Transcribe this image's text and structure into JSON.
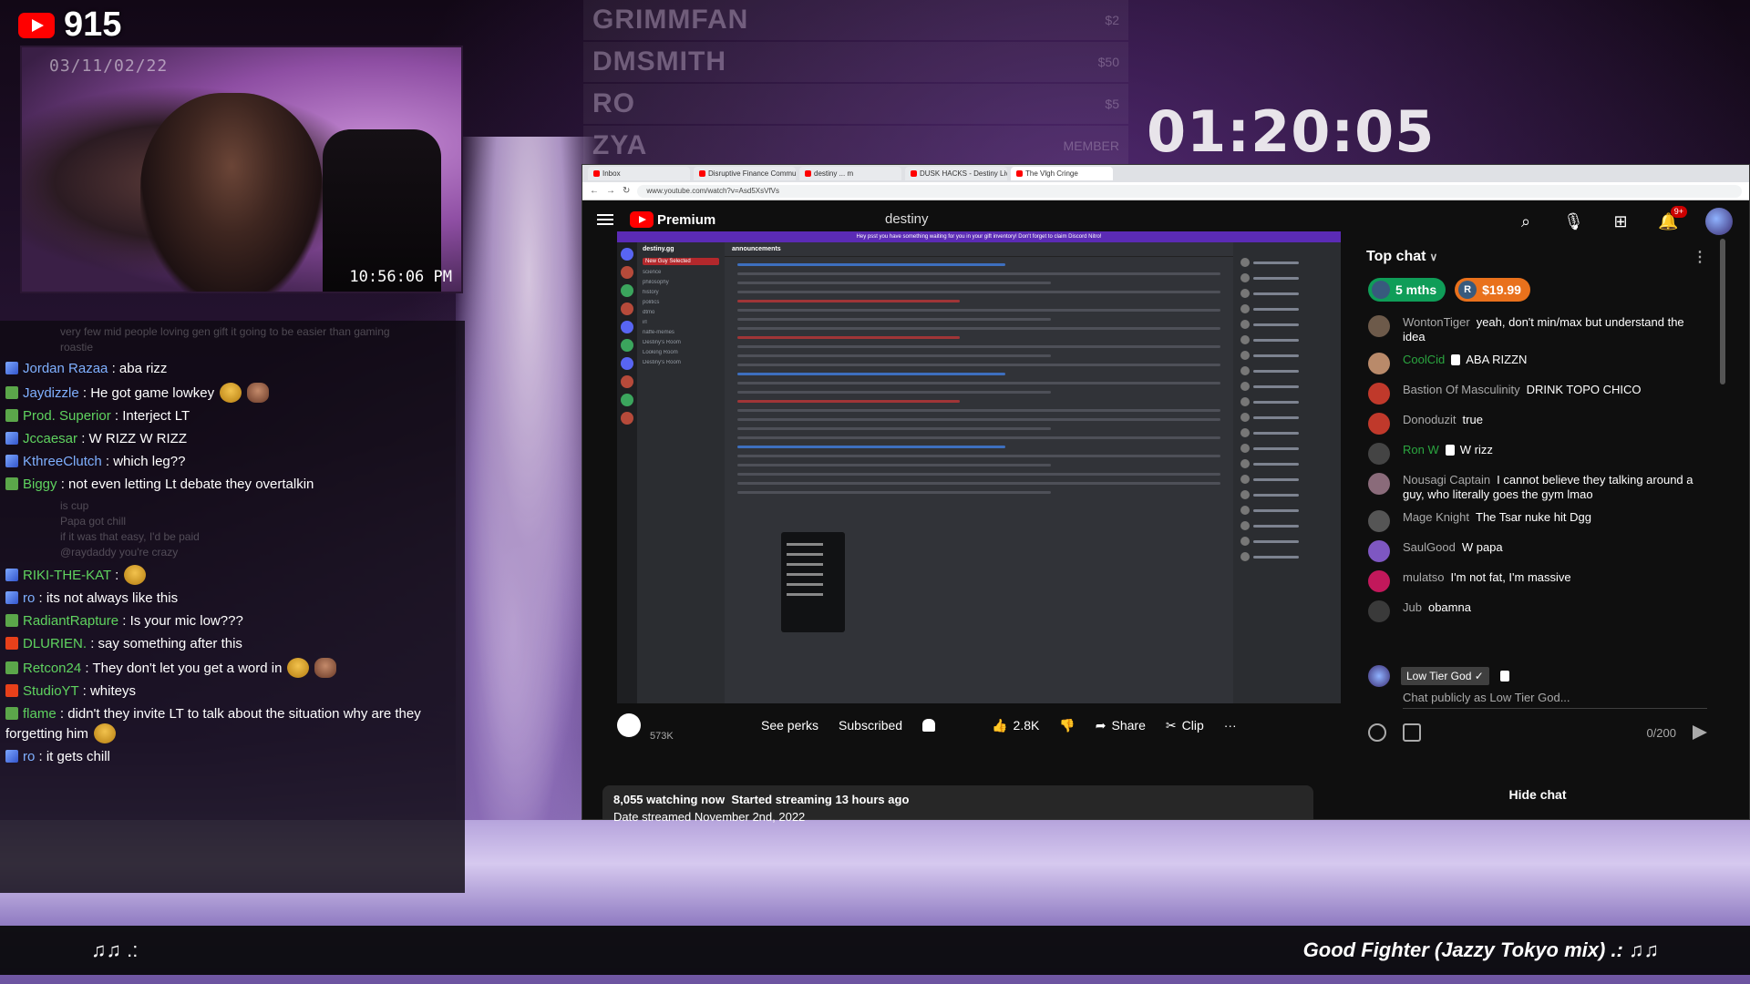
{
  "stream": {
    "viewer_count": "915",
    "timer": "01:20:05",
    "webcam_date": "03/11/02/22",
    "webcam_clock": "10:56:06 PM"
  },
  "leaderboard": [
    {
      "name": "GRIMMFAN",
      "value": "$2"
    },
    {
      "name": "DMSMITH",
      "value": "$50"
    },
    {
      "name": "RO",
      "value": "$5"
    },
    {
      "name": "ZYA",
      "value": "MEMBER"
    }
  ],
  "left_chat": {
    "faint_top": "very few mid people loving gen gift it going to be easier than gaming",
    "faint_top2": "roastie",
    "messages": [
      {
        "user": "Jordan Razaa",
        "color": "#7fb0ff",
        "badge": "sword",
        "text": ": aba rizz"
      },
      {
        "user": "Jaydizzle",
        "color": "#7fb0ff",
        "badge": "hat",
        "text": ": He got game lowkey",
        "emotes": 2
      },
      {
        "user": "Prod. Superior",
        "color": "#5fd35f",
        "badge": "hat",
        "text": ": Interject LT"
      },
      {
        "user": "Jccaesar",
        "color": "#5fd35f",
        "badge": "sword",
        "text": ": W RIZZ W RIZZ"
      },
      {
        "user": "KthreeClutch",
        "color": "#7fb0ff",
        "badge": "sword",
        "text": ": which leg??"
      },
      {
        "user": "Biggy",
        "color": "#5fd35f",
        "badge": "hat",
        "text": ": not even letting Lt debate they overtalkin"
      },
      {
        "user": "RIKI-THE-KAT",
        "color": "#5fd35f",
        "badge": "sword",
        "text": ":",
        "emotes": 1
      },
      {
        "user": "ro",
        "color": "#7fb0ff",
        "badge": "sword",
        "text": ": its not always like this"
      },
      {
        "user": "RadiantRapture",
        "color": "#5fd35f",
        "badge": "hat",
        "text": ": Is your mic low???"
      },
      {
        "user": "DLURIEN.",
        "color": "#5fd35f",
        "badge": "fire",
        "text": ": say something after this"
      },
      {
        "user": "Retcon24",
        "color": "#5fd35f",
        "badge": "hat",
        "text": ": They don't let you get a word in",
        "emotes": 2
      },
      {
        "user": "StudioYT",
        "color": "#5fd35f",
        "badge": "fire",
        "text": ": whiteys"
      },
      {
        "user": "flame",
        "color": "#5fd35f",
        "badge": "hat",
        "text": ": didn't they invite LT to talk about the situation why are they forgetting him",
        "emotes": 1
      },
      {
        "user": "ro",
        "color": "#7fb0ff",
        "badge": "sword",
        "text": ": it gets chill"
      }
    ],
    "faint_mid": [
      "is cup",
      "Papa got chill",
      "if it was that easy, I'd be paid",
      "@raydaddy you're crazy"
    ]
  },
  "browser": {
    "tabs": [
      "Inbox",
      "Disruptive Finance Commu...",
      "destiny ... m",
      "DUSK HACKS - Destiny Live ...",
      "The Vlgh Cringe"
    ],
    "address": "www.youtube.com/watch?v=Asd5XsVfVs",
    "yt_premium": "Premium",
    "search_query": "destiny",
    "notif_count": "9+"
  },
  "video": {
    "discord_banner": "Hey psst you have something waiting for you in your gift inventory! Don't forget to claim Discord Nitro!",
    "guild_name": "destiny.gg",
    "channel_header": "announcements",
    "channels": [
      "New Guy Selected",
      "science",
      "philosophy",
      "history",
      "politics",
      "dtmo",
      "irl",
      "naffe-memes",
      "Destiny's Room",
      "Looking Room",
      "Destiny's Room"
    ]
  },
  "actions": {
    "subs": "573K",
    "see_perks": "See perks",
    "subscribed": "Subscribed",
    "likes": "2.8K",
    "share": "Share",
    "clip": "Clip",
    "more": "···"
  },
  "info": {
    "watching": "8,055 watching now",
    "started": "Started streaming 13 hours ago",
    "date": "Date streamed November 2nd, 2022"
  },
  "live_chat": {
    "header": "Top chat",
    "ticker": [
      {
        "label": "5 mths",
        "initial": "",
        "color": "#0f9d58"
      },
      {
        "label": "$19.99",
        "initial": "R",
        "color": "#e9711c"
      }
    ],
    "messages": [
      {
        "author": "WontonTiger",
        "member": false,
        "text": "yeah, don't min/max but understand the idea",
        "avatar_color": "#6d5a4a"
      },
      {
        "author": "CoolCid",
        "member": true,
        "text": "ABA RIZZN",
        "avatar_color": "#b98a6a"
      },
      {
        "author": "Bastion Of Masculinity",
        "member": false,
        "text": "DRINK TOPO CHICO",
        "avatar_color": "#c0392b"
      },
      {
        "author": "Donoduzit",
        "member": false,
        "text": "true",
        "avatar_color": "#c0392b"
      },
      {
        "author": "Ron W",
        "member": true,
        "text": "W rizz",
        "avatar_color": "#444"
      },
      {
        "author": "Nousagi Captain",
        "member": false,
        "text": "I cannot believe they talking around a guy, who literally goes the gym lmao",
        "avatar_color": "#8a6b7a"
      },
      {
        "author": "Mage Knight",
        "member": false,
        "text": "The Tsar nuke hit Dgg",
        "avatar_color": "#555"
      },
      {
        "author": "SaulGood",
        "member": false,
        "text": "W papa",
        "avatar_color": "#7e57c2"
      },
      {
        "author": "mulatso",
        "member": false,
        "text": "I'm not fat, I'm massive",
        "avatar_color": "#c2185b"
      },
      {
        "author": "Jub",
        "member": false,
        "text": "obamna",
        "avatar_color": "#3a3a3a"
      }
    ],
    "self_name": "Low Tier God ✓",
    "input_placeholder": "Chat publicly as Low Tier God...",
    "char_count": "0/200",
    "hide_chat": "Hide chat"
  },
  "music": {
    "left": "♫♫ .:",
    "title": "Good Fighter (Jazzy Tokyo mix)  .: ♫♫"
  }
}
